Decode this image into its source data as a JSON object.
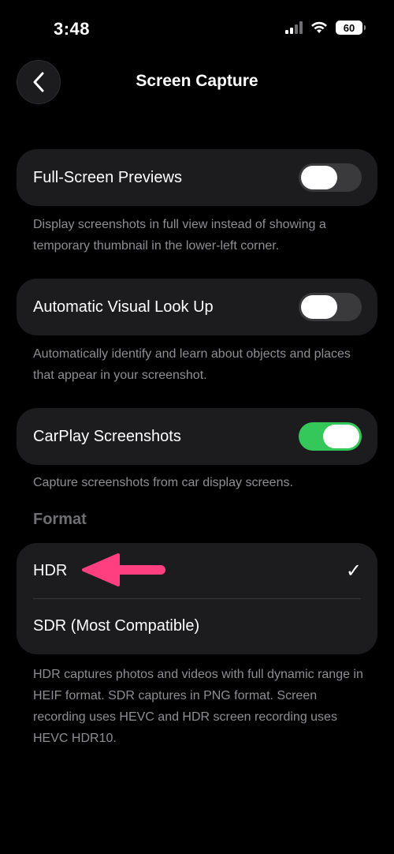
{
  "status_bar": {
    "time": "3:48",
    "battery": "60",
    "icons": [
      "signal-icon",
      "wifi-icon",
      "battery-icon"
    ]
  },
  "nav": {
    "back_icon": "chevron-left-icon",
    "title": "Screen Capture"
  },
  "settings": {
    "full_screen_previews": {
      "label": "Full-Screen Previews",
      "on": false,
      "footnote": "Display screenshots in full view instead of showing a temporary thumbnail in the lower-left corner."
    },
    "visual_look_up": {
      "label": "Automatic Visual Look Up",
      "on": false,
      "footnote": "Automatically identify and learn about objects and places that appear in your screenshot."
    },
    "carplay": {
      "label": "CarPlay Screenshots",
      "on": true,
      "footnote": "Capture screenshots from car display screens."
    }
  },
  "format": {
    "header": "Format",
    "options": [
      {
        "label": "HDR",
        "selected": true
      },
      {
        "label": "SDR (Most Compatible)",
        "selected": false
      }
    ],
    "checkmark": "✓",
    "footnote": "HDR captures photos and videos with full dynamic range in HEIF format. SDR captures in PNG format. Screen recording uses HEVC and HDR screen recording uses HEVC HDR10."
  },
  "colors": {
    "background": "#000000",
    "group": "#1c1c1e",
    "toggle_on": "#34c759",
    "toggle_off": "#3a3a3c",
    "footnote": "#8e8e93",
    "annotation_arrow": "#ff3f7f"
  }
}
